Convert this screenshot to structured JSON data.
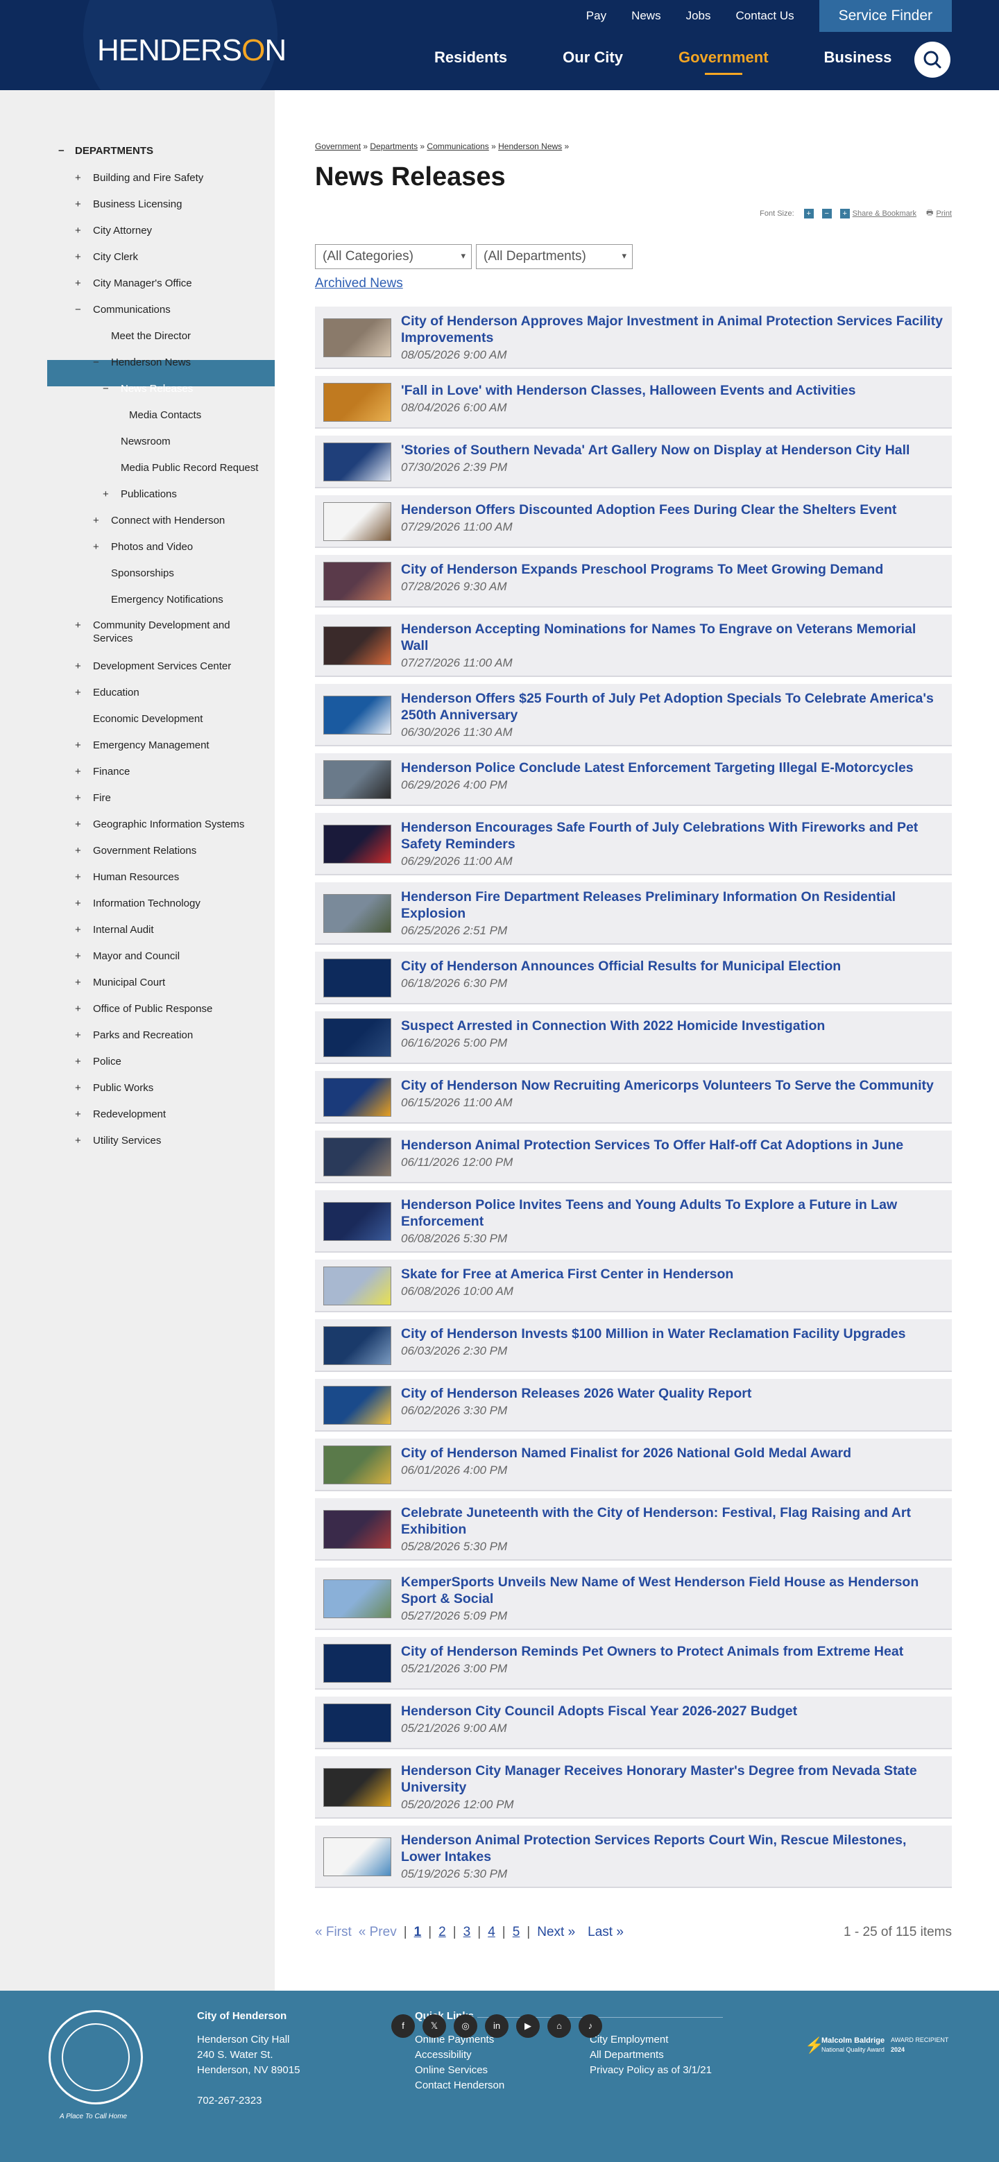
{
  "header": {
    "logo": "HENDERS",
    "logo_o": "O",
    "logo_n": "N",
    "utility": [
      "Pay",
      "News",
      "Jobs",
      "Contact Us"
    ],
    "finder": "Service Finder",
    "nav": [
      "Residents",
      "Our City",
      "Government",
      "Business"
    ]
  },
  "sidebar": {
    "items": [
      {
        "sym": "−",
        "label": "DEPARTMENTS",
        "lvl": 0
      },
      {
        "sym": "+",
        "label": "Building and Fire Safety",
        "lvl": 1
      },
      {
        "sym": "+",
        "label": "Business Licensing",
        "lvl": 1
      },
      {
        "sym": "+",
        "label": "City Attorney",
        "lvl": 1
      },
      {
        "sym": "+",
        "label": "City Clerk",
        "lvl": 1
      },
      {
        "sym": "+",
        "label": "City Manager's Office",
        "lvl": 1
      },
      {
        "sym": "−",
        "label": "Communications",
        "lvl": 1
      },
      {
        "sym": "",
        "label": "Meet the Director",
        "lvl": 2
      },
      {
        "sym": "−",
        "label": "Henderson News",
        "lvl": 2
      },
      {
        "sym": "−",
        "label": "News Releases",
        "lvl": 3
      },
      {
        "sym": "",
        "label": "Media Contacts",
        "lvl": 4
      },
      {
        "sym": "",
        "label": "Newsroom",
        "lvl": 3
      },
      {
        "sym": "",
        "label": "Media Public Record Request",
        "lvl": 3
      },
      {
        "sym": "+",
        "label": "Publications",
        "lvl": 3
      },
      {
        "sym": "+",
        "label": "Connect with Henderson",
        "lvl": 2
      },
      {
        "sym": "+",
        "label": "Photos and Video",
        "lvl": 2
      },
      {
        "sym": "",
        "label": "Sponsorships",
        "lvl": 2
      },
      {
        "sym": "",
        "label": "Emergency Notifications",
        "lvl": 2
      },
      {
        "sym": "+",
        "label": "Community Development and Services",
        "lvl": 1
      },
      {
        "sym": "+",
        "label": "Development Services Center",
        "lvl": 1
      },
      {
        "sym": "+",
        "label": "Education",
        "lvl": 1
      },
      {
        "sym": "",
        "label": "Economic Development",
        "lvl": 1
      },
      {
        "sym": "+",
        "label": "Emergency Management",
        "lvl": 1
      },
      {
        "sym": "+",
        "label": "Finance",
        "lvl": 1
      },
      {
        "sym": "+",
        "label": "Fire",
        "lvl": 1
      },
      {
        "sym": "+",
        "label": "Geographic Information Systems",
        "lvl": 1
      },
      {
        "sym": "+",
        "label": "Government Relations",
        "lvl": 1
      },
      {
        "sym": "+",
        "label": "Human Resources",
        "lvl": 1
      },
      {
        "sym": "+",
        "label": "Information Technology",
        "lvl": 1
      },
      {
        "sym": "+",
        "label": "Internal Audit",
        "lvl": 1
      },
      {
        "sym": "+",
        "label": "Mayor and Council",
        "lvl": 1
      },
      {
        "sym": "+",
        "label": "Municipal Court",
        "lvl": 1
      },
      {
        "sym": "+",
        "label": "Office of Public Response",
        "lvl": 1
      },
      {
        "sym": "+",
        "label": "Parks and Recreation",
        "lvl": 1
      },
      {
        "sym": "+",
        "label": "Police",
        "lvl": 1
      },
      {
        "sym": "+",
        "label": "Public Works",
        "lvl": 1
      },
      {
        "sym": "+",
        "label": "Redevelopment",
        "lvl": 1
      },
      {
        "sym": "+",
        "label": "Utility Services",
        "lvl": 1
      }
    ]
  },
  "main": {
    "breadcrumbs": [
      "Government",
      "Departments",
      "Communications",
      "Henderson News"
    ],
    "title": "News Releases",
    "font_size_label": "Font Size:",
    "share": "Share & Bookmark",
    "print": "Print",
    "category_select": "(All Categories)",
    "department_select": "(All Departments)",
    "archived": "Archived News"
  },
  "news": [
    {
      "title": "City of Henderson Approves Major Investment in Animal Protection Services Facility Improvements",
      "date": "08/05/2026 9:00 AM",
      "c1": "#8a7a6a",
      "c2": "#d8c8b4"
    },
    {
      "title": "'Fall in Love' with Henderson Classes, Halloween Events and Activities",
      "date": "08/04/2026 6:00 AM",
      "c1": "#c07a20",
      "c2": "#e8b050"
    },
    {
      "title": "'Stories of Southern Nevada' Art Gallery Now on Display at Henderson City Hall",
      "date": "07/30/2026 2:39 PM",
      "c1": "#1f3f7a",
      "c2": "#dfe6f2"
    },
    {
      "title": "Henderson Offers Discounted Adoption Fees During Clear the Shelters Event",
      "date": "07/29/2026 11:00 AM",
      "c1": "#f4f4f4",
      "c2": "#7a5a3a"
    },
    {
      "title": "City of Henderson Expands Preschool Programs To Meet Growing Demand",
      "date": "07/28/2026 9:30 AM",
      "c1": "#5a3a4a",
      "c2": "#c87a5a"
    },
    {
      "title": "Henderson Accepting Nominations for Names To Engrave on Veterans Memorial Wall",
      "date": "07/27/2026 11:00 AM",
      "c1": "#3a2a2a",
      "c2": "#d86a3a"
    },
    {
      "title": "Henderson Offers $25 Fourth of July Pet Adoption Specials To Celebrate America's 250th Anniversary",
      "date": "06/30/2026 11:30 AM",
      "c1": "#1a5aa0",
      "c2": "#e8eef6"
    },
    {
      "title": "Henderson Police Conclude Latest Enforcement Targeting Illegal E-Motorcycles",
      "date": "06/29/2026 4:00 PM",
      "c1": "#6a7a8a",
      "c2": "#2a2a2a"
    },
    {
      "title": "Henderson Encourages Safe Fourth of July Celebrations With Fireworks and Pet Safety Reminders",
      "date": "06/29/2026 11:00 AM",
      "c1": "#1a1a3a",
      "c2": "#c82a2a"
    },
    {
      "title": "Henderson Fire Department Releases Preliminary Information On Residential Explosion",
      "date": "06/25/2026 2:51 PM",
      "c1": "#7a8a9a",
      "c2": "#4a5a3a"
    },
    {
      "title": "City of Henderson Announces Official Results for Municipal Election",
      "date": "06/18/2026 6:30 PM",
      "c1": "#0d2a5c",
      "c2": "#0d2a5c"
    },
    {
      "title": "Suspect Arrested in Connection With 2022 Homicide Investigation",
      "date": "06/16/2026 5:00 PM",
      "c1": "#0d2a5c",
      "c2": "#2a4a7c"
    },
    {
      "title": "City of Henderson Now Recruiting Americorps Volunteers To Serve the Community",
      "date": "06/15/2026 11:00 AM",
      "c1": "#1a3a7a",
      "c2": "#e8a020"
    },
    {
      "title": "Henderson Animal Protection Services To Offer Half-off Cat Adoptions in June",
      "date": "06/11/2026 12:00 PM",
      "c1": "#2a3a5a",
      "c2": "#8a7a6a"
    },
    {
      "title": "Henderson Police Invites Teens and Young Adults To Explore a Future in Law Enforcement",
      "date": "06/08/2026 5:30 PM",
      "c1": "#1a2a5a",
      "c2": "#3a5a9a"
    },
    {
      "title": "Skate for Free at America First Center in Henderson",
      "date": "06/08/2026 10:00 AM",
      "c1": "#a8b8d0",
      "c2": "#e8e050"
    },
    {
      "title": "City of Henderson Invests $100 Million in Water Reclamation Facility Upgrades",
      "date": "06/03/2026 2:30 PM",
      "c1": "#1a3a6a",
      "c2": "#7a9ac0"
    },
    {
      "title": "City of Henderson Releases 2026 Water Quality Report",
      "date": "06/02/2026 3:30 PM",
      "c1": "#1a4a8a",
      "c2": "#f0c040"
    },
    {
      "title": "City of Henderson Named Finalist for 2026 National Gold Medal Award",
      "date": "06/01/2026 4:00 PM",
      "c1": "#5a7a4a",
      "c2": "#d8b040"
    },
    {
      "title": "Celebrate Juneteenth with the City of Henderson: Festival, Flag Raising and Art Exhibition",
      "date": "05/28/2026 5:30 PM",
      "c1": "#3a2a4a",
      "c2": "#a83a3a"
    },
    {
      "title": "KemperSports Unveils New Name of West Henderson Field House as Henderson Sport & Social",
      "date": "05/27/2026 5:09 PM",
      "c1": "#8ab0d8",
      "c2": "#6a8a5a"
    },
    {
      "title": "City of Henderson Reminds Pet Owners to Protect Animals from Extreme Heat",
      "date": "05/21/2026 3:00 PM",
      "c1": "#0d2a5c",
      "c2": "#0d2a5c"
    },
    {
      "title": "Henderson City Council Adopts Fiscal Year 2026-2027 Budget",
      "date": "05/21/2026 9:00 AM",
      "c1": "#0d2a5c",
      "c2": "#0d2a5c"
    },
    {
      "title": "Henderson City Manager Receives Honorary Master's Degree from Nevada State University",
      "date": "05/20/2026 12:00 PM",
      "c1": "#2a2a2a",
      "c2": "#d8a020"
    },
    {
      "title": "Henderson Animal Protection Services Reports Court Win, Rescue Milestones, Lower Intakes",
      "date": "05/19/2026 5:30 PM",
      "c1": "#f4f4f4",
      "c2": "#4a8ac0"
    }
  ],
  "pagination": {
    "first": "« First",
    "prev": "« Prev",
    "pages": [
      "1",
      "2",
      "3",
      "4",
      "5"
    ],
    "next": "Next »",
    "last": "Last »",
    "count": "1 - 25 of 115 items"
  },
  "footer": {
    "seal_text": "A Place To Call Home",
    "city": "City of Henderson",
    "addr1": "Henderson City Hall",
    "addr2": "240 S. Water St.",
    "addr3": "Henderson, NV 89015",
    "phone": "702-267-2323",
    "quick_title": "Quick Links",
    "links_col1": [
      "Online Payments",
      "Accessibility",
      "Online Services",
      "Contact Henderson"
    ],
    "links_col2": [
      "City Employment",
      "All Departments",
      "Privacy Policy as of 3/1/21"
    ],
    "award1": "Malcolm Baldrige",
    "award2": "National Quality Award",
    "award3": "AWARD RECIPIENT",
    "award4": "2024"
  },
  "social": [
    "facebook",
    "x",
    "instagram",
    "linkedin",
    "youtube",
    "nextdoor",
    "tiktok"
  ]
}
